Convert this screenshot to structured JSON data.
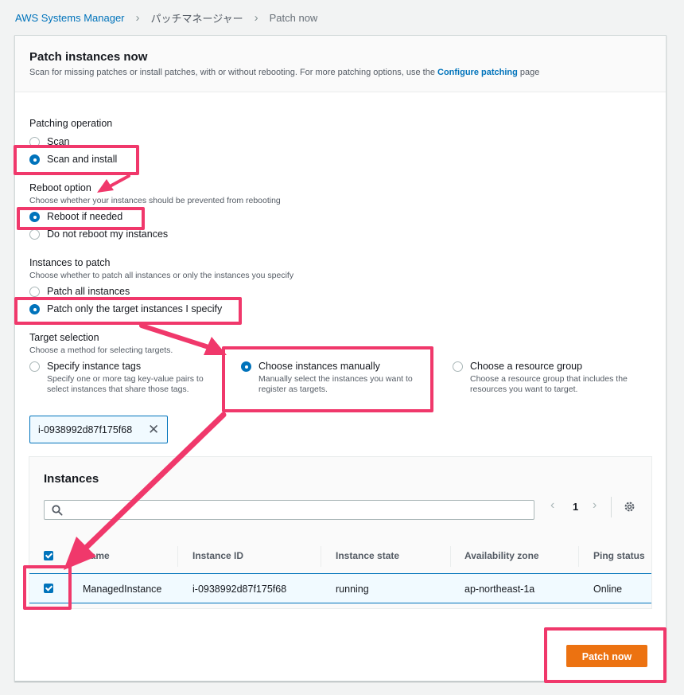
{
  "breadcrumb": {
    "root": "AWS Systems Manager",
    "middle": "パッチマネージャー",
    "current": "Patch now"
  },
  "header": {
    "title": "Patch instances now",
    "subtitle_pre": "Scan for missing patches or install patches, with or without rebooting. For more patching options, use the ",
    "subtitle_link": "Configure patching",
    "subtitle_post": " page"
  },
  "patching_operation": {
    "label": "Patching operation",
    "options": [
      "Scan",
      "Scan and install"
    ],
    "selected": "Scan and install"
  },
  "reboot_option": {
    "label": "Reboot option",
    "description": "Choose whether your instances should be prevented from rebooting",
    "options": [
      "Reboot if needed",
      "Do not reboot my instances"
    ],
    "selected": "Reboot if needed"
  },
  "instances_to_patch": {
    "label": "Instances to patch",
    "description": "Choose whether to patch all instances or only the instances you specify",
    "options": [
      "Patch all instances",
      "Patch only the target instances I specify"
    ],
    "selected": "Patch only the target instances I specify"
  },
  "target_selection": {
    "label": "Target selection",
    "description": "Choose a method for selecting targets.",
    "options": [
      {
        "title": "Specify instance tags",
        "desc1": "Specify one or more tag key-value pairs to",
        "desc2": "select instances that share those tags."
      },
      {
        "title": "Choose instances manually",
        "desc1": "Manually select the instances you want to",
        "desc2": "register as targets."
      },
      {
        "title": "Choose a resource group",
        "desc1": "Choose a resource group that includes the",
        "desc2": "resources you want to target."
      }
    ],
    "selected": "Choose instances manually"
  },
  "token": {
    "value": "i-0938992d87f175f68",
    "remove_glyph": "✕"
  },
  "instances": {
    "title": "Instances",
    "search_placeholder": "",
    "page": "1",
    "columns": [
      "Name",
      "Instance ID",
      "Instance state",
      "Availability zone",
      "Ping status"
    ],
    "rows": [
      {
        "name": "ManagedInstance",
        "instance_id": "i-0938992d87f175f68",
        "state": "running",
        "az": "ap-northeast-1a",
        "ping": "Online",
        "checked": true
      }
    ]
  },
  "actions": {
    "patch_now": "Patch now"
  },
  "colors": {
    "accent": "#0073bb",
    "primary_button": "#ec7211",
    "annotation": "#f0386b"
  }
}
